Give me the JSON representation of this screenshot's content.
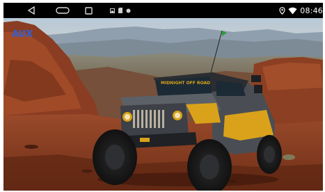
{
  "status_bar": {
    "time": "08:46",
    "nav_buttons": [
      "back",
      "home",
      "recent-apps"
    ],
    "notification_icons": [
      "gallery-icon",
      "sd-card-icon",
      "settings-dot-icon"
    ],
    "system_icons": [
      "location-icon",
      "wifi-icon"
    ]
  },
  "main": {
    "source_label": "AUX",
    "wallpaper_subject": "off-road jeep on red rock trail",
    "jeep_windshield_text": "MIDNIGHT OFF ROAD"
  },
  "colors": {
    "status_bar_bg": "#000000",
    "source_label": "#2f5fd6",
    "jeep_body": "#4a4e54",
    "jeep_accent": "#d9a21a",
    "red_rock": "#8a3d22"
  }
}
